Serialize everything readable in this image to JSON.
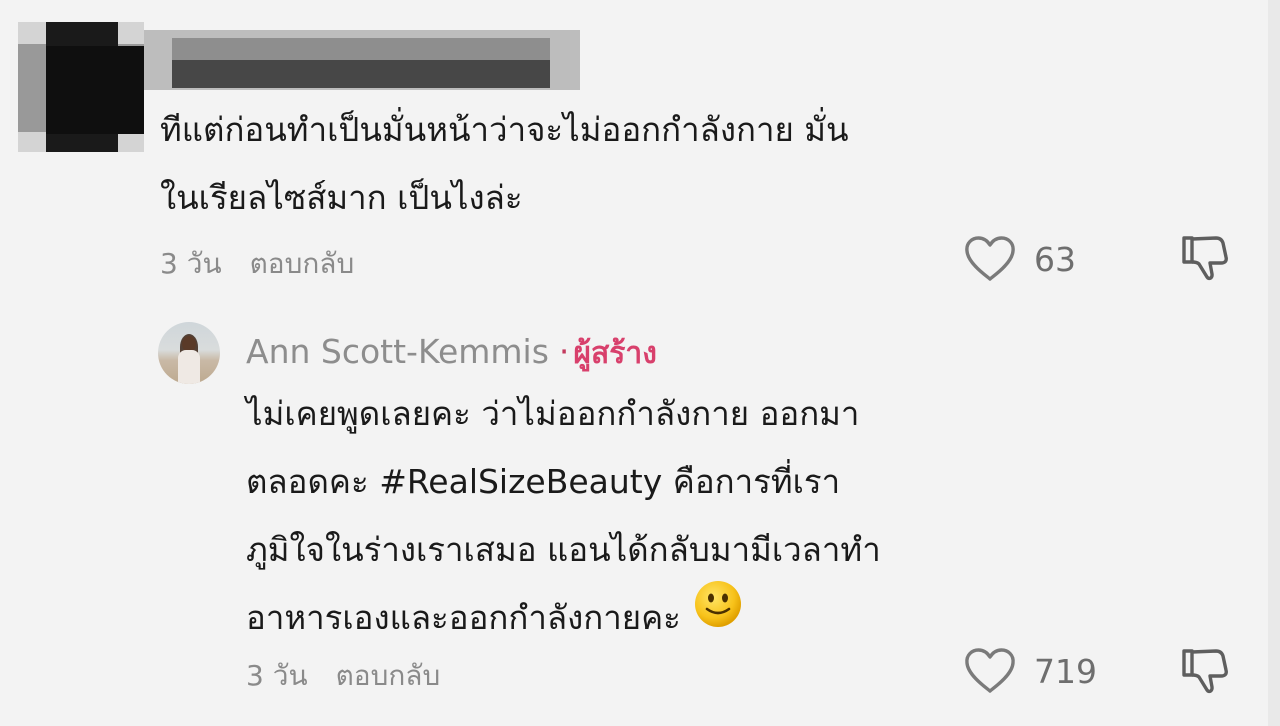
{
  "comments": [
    {
      "author": "",
      "text_lines": [
        "ทีแต่ก่อนทำเป็นมั่นหน้าว่าจะไม่ออกกำลังกาย มั่น",
        "ในเรียลไซส์มาก เป็นไงล่ะ"
      ],
      "time": "3 วัน",
      "reply_label": "ตอบกลับ",
      "likes": "63"
    },
    {
      "author": "Ann Scott-Kemmis",
      "separator": "·",
      "badge": "ผู้สร้าง",
      "text_lines": [
        "ไม่เคยพูดเลยคะ ว่าไม่ออกกำลังกาย ออกมา",
        "ตลอดคะ #RealSizeBeauty คือการที่เรา",
        "ภูมิใจในร่างเราเสมอ แอนได้กลับมามีเวลาทำ",
        "อาหารเองและออกกำลังกายคะ"
      ],
      "time": "3 วัน",
      "reply_label": "ตอบกลับ",
      "likes": "719"
    }
  ],
  "icons": {
    "like": "heart-outline-icon",
    "dislike": "thumbs-down-outline-icon",
    "emoji": "slightly-smiling-face-emoji"
  },
  "colors": {
    "background": "#f3f3f3",
    "creator_badge": "#d8406c",
    "meta_text": "#8a8a8a"
  }
}
